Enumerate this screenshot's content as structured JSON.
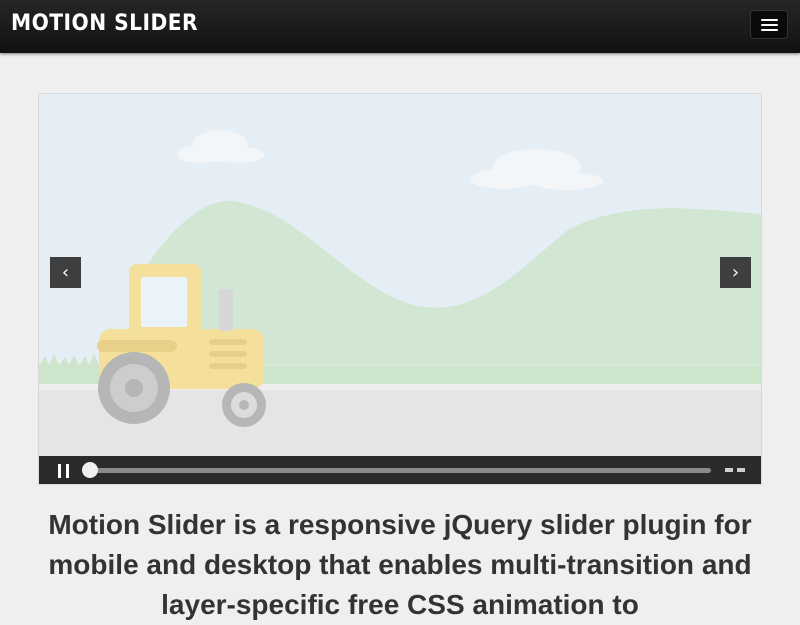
{
  "header": {
    "logo_text": "MOTION SLIDER",
    "menu_icon": "hamburger-menu-icon"
  },
  "slider": {
    "prev_label": "‹",
    "next_label": "›",
    "prev_icon": "chevron-left-icon",
    "next_icon": "chevron-right-icon",
    "pause_icon": "pause-icon",
    "thumbnails_icon": "thumbnails-icon",
    "progress": 0.0,
    "scene": {
      "sky_color": "#dde8f2",
      "hill_color": "#c2dfc4",
      "grass_color": "#c9e2c7",
      "road_color": "#dcdcdc",
      "tractor_color": "#f2d67a",
      "wheel_color": "#9e9e9e"
    }
  },
  "main": {
    "headline": "Motion Slider is a responsive jQuery slider plugin for mobile and desktop that enables multi-transition and layer-specific free CSS animation to"
  },
  "colors": {
    "topbar": "#1c1c1c",
    "page_background": "#efefef",
    "controlbar": "#2b2b2b",
    "text": "#333333"
  }
}
